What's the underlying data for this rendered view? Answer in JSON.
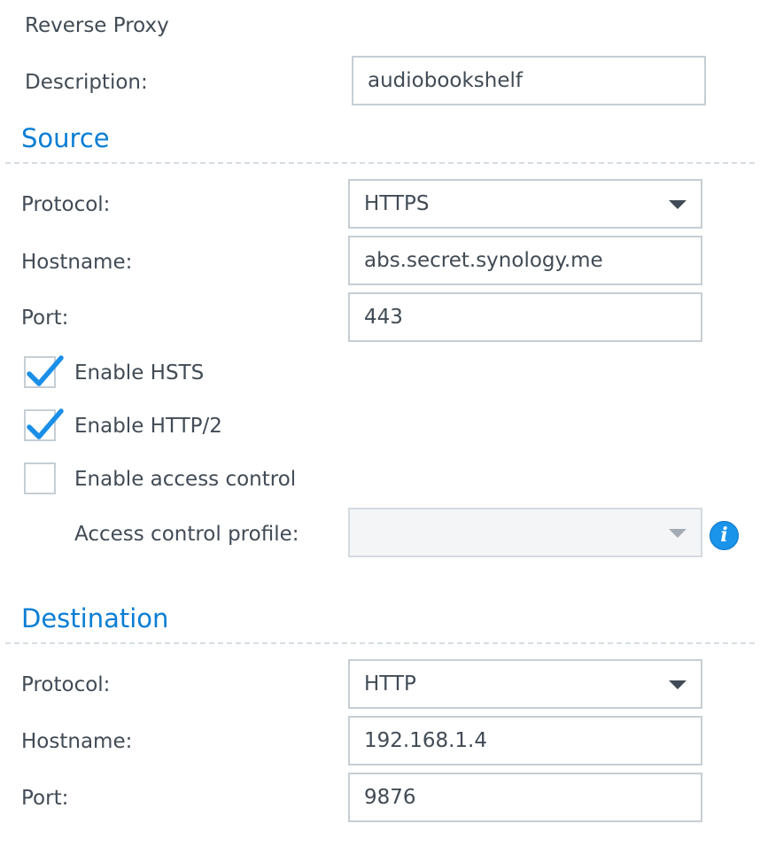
{
  "header": {
    "title": "Reverse Proxy",
    "description_label": "Description:",
    "description_value": "audiobookshelf"
  },
  "source": {
    "title": "Source",
    "protocol_label": "Protocol:",
    "protocol_value": "HTTPS",
    "hostname_label": "Hostname:",
    "hostname_value": "abs.secret.synology.me",
    "port_label": "Port:",
    "port_value": "443",
    "hsts_label": "Enable HSTS",
    "hsts_checked": true,
    "http2_label": "Enable HTTP/2",
    "http2_checked": true,
    "access_control_label": "Enable access control",
    "access_control_checked": false,
    "access_profile_label": "Access control profile:",
    "access_profile_value": "",
    "info_icon": "info-icon"
  },
  "destination": {
    "title": "Destination",
    "protocol_label": "Protocol:",
    "protocol_value": "HTTP",
    "hostname_label": "Hostname:",
    "hostname_value": "192.168.1.4",
    "port_label": "Port:",
    "port_value": "9876"
  },
  "colors": {
    "accent": "#0a7ed4",
    "check": "#1a8fe8",
    "text": "#414b55",
    "border": "#c6ced5"
  }
}
